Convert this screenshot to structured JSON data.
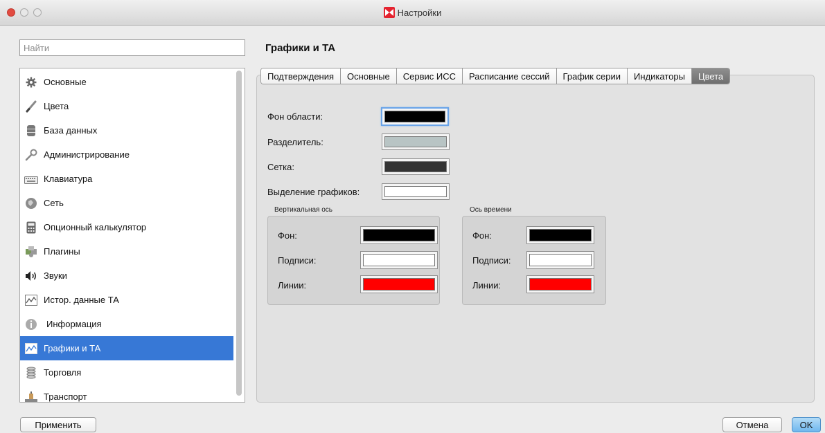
{
  "window": {
    "title": "Настройки"
  },
  "search": {
    "placeholder": "Найти"
  },
  "sidebar": {
    "items": [
      {
        "label": "Основные",
        "icon": "gear-icon"
      },
      {
        "label": "Цвета",
        "icon": "brush-icon"
      },
      {
        "label": "База данных",
        "icon": "database-icon"
      },
      {
        "label": "Администрирование",
        "icon": "wrench-icon"
      },
      {
        "label": "Клавиатура",
        "icon": "keyboard-icon"
      },
      {
        "label": "Сеть",
        "icon": "network-icon"
      },
      {
        "label": "Опционный калькулятор",
        "icon": "calculator-icon"
      },
      {
        "label": "Плагины",
        "icon": "puzzle-icon"
      },
      {
        "label": "Звуки",
        "icon": "speaker-icon"
      },
      {
        "label": "Истор. данные ТА",
        "icon": "history-chart-icon"
      },
      {
        "label": "Информация",
        "icon": "info-icon"
      },
      {
        "label": "Графики и ТА",
        "icon": "chart-icon",
        "selected": true
      },
      {
        "label": "Торговля",
        "icon": "coins-icon"
      },
      {
        "label": "Транспорт",
        "icon": "transport-icon"
      }
    ]
  },
  "page": {
    "title": "Графики и ТА"
  },
  "tabs": [
    {
      "label": "Подтверждения"
    },
    {
      "label": "Основные"
    },
    {
      "label": "Сервис ИСС"
    },
    {
      "label": "Расписание сессий"
    },
    {
      "label": "График серии"
    },
    {
      "label": "Индикаторы"
    },
    {
      "label": "Цвета",
      "active": true
    }
  ],
  "colors": {
    "area_bg": {
      "label": "Фон области:",
      "color": "#000000"
    },
    "separator": {
      "label": "Разделитель:",
      "color": "#b8c4c4"
    },
    "grid": {
      "label": "Сетка:",
      "color": "#333333"
    },
    "chart_selection": {
      "label": "Выделение графиков:",
      "color": "#ffffff"
    }
  },
  "vertical_axis": {
    "caption": "Вертикальная ось",
    "background": {
      "label": "Фон:",
      "color": "#000000"
    },
    "captions": {
      "label": "Подписи:",
      "color": "#ffffff"
    },
    "lines": {
      "label": "Линии:",
      "color": "#ff0000"
    }
  },
  "time_axis": {
    "caption": "Ось времени",
    "background": {
      "label": "Фон:",
      "color": "#000000"
    },
    "captions": {
      "label": "Подписи:",
      "color": "#ffffff"
    },
    "lines": {
      "label": "Линии:",
      "color": "#ff0000"
    }
  },
  "buttons": {
    "apply": "Применить",
    "cancel": "Отмена",
    "ok": "OK"
  }
}
